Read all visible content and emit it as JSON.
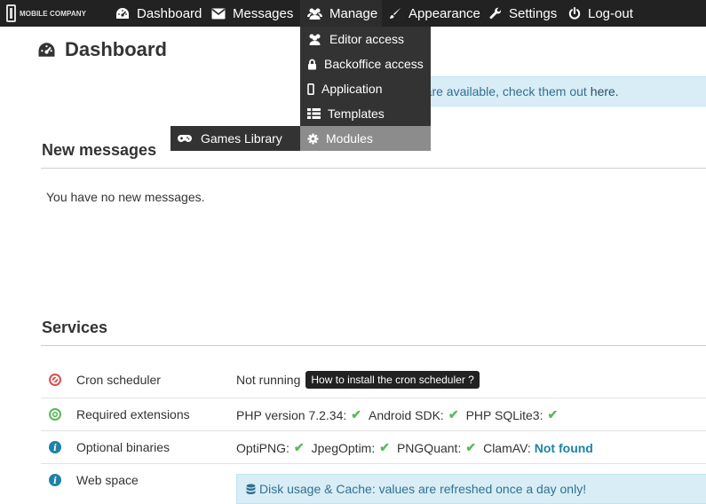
{
  "navbar": {
    "logo_text": "MOBILE COMPANY",
    "items": [
      {
        "label": "Dashboard",
        "icon": "dashboard-icon"
      },
      {
        "label": "Messages",
        "icon": "envelope-icon"
      },
      {
        "label": "Manage",
        "icon": "users-icon"
      },
      {
        "label": "Appearance",
        "icon": "brush-icon"
      },
      {
        "label": "Settings",
        "icon": "wrench-icon"
      },
      {
        "label": "Log-out",
        "icon": "power-icon"
      }
    ]
  },
  "manage_menu": {
    "items": [
      {
        "label": "Editor access",
        "icon": "users-icon"
      },
      {
        "label": "Backoffice access",
        "icon": "lock-icon"
      },
      {
        "label": "Application",
        "icon": "mobile-icon"
      },
      {
        "label": "Templates",
        "icon": "table-icon"
      },
      {
        "label": "Modules",
        "icon": "gear-icon"
      }
    ],
    "submenu": {
      "label": "Games Library",
      "icon": "gamepad-icon"
    }
  },
  "page": {
    "title": "Dashboard"
  },
  "alert": {
    "text": "es are available, check them out",
    "link": "here."
  },
  "messages": {
    "title": "New messages",
    "empty_text": "You have no new messages."
  },
  "services": {
    "title": "Services",
    "rows": [
      {
        "name": "Cron scheduler",
        "status": "error",
        "value": "Not running",
        "badge": "How to install the cron scheduler ?"
      },
      {
        "name": "Required extensions",
        "status": "ok",
        "items": [
          "PHP version 7.2.34:",
          "Android SDK:",
          "PHP SQLite3:"
        ]
      },
      {
        "name": "Optional binaries",
        "status": "info",
        "items": [
          "OptiPNG:",
          "JpegOptim:",
          "PNGQuant:",
          "ClamAV:"
        ],
        "not_found": "Not found"
      },
      {
        "name": "Web space",
        "status": "info",
        "note": "Disk usage & Cache: values are refreshed once a day only!"
      }
    ]
  },
  "colors": {
    "navbar": "#222222",
    "dropdown": "#333333",
    "hover": "#8c8c8c",
    "success": "#5cb85c",
    "danger": "#d9534f",
    "info": "#1e82a8"
  }
}
